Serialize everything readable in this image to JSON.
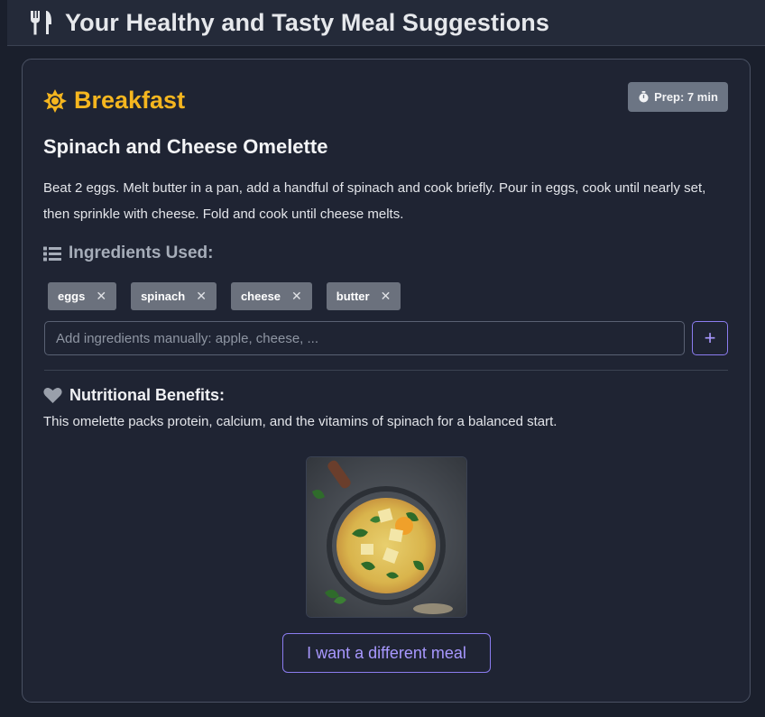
{
  "header": {
    "title": "Your Healthy and Tasty Meal Suggestions",
    "icon": "fork-knife-icon"
  },
  "meal": {
    "type": "Breakfast",
    "type_icon": "sun-icon",
    "prep": "Prep: 7 min",
    "name": "Spinach and Cheese Omelette",
    "description": "Beat 2 eggs. Melt butter in a pan, add a handful of spinach and cook briefly. Pour in eggs, cook until nearly set, then sprinkle with cheese. Fold and cook until cheese melts.",
    "ingredients_heading": "Ingredients Used:",
    "ingredients": [
      "eggs",
      "spinach",
      "cheese",
      "butter"
    ],
    "remove_glyph": "✕",
    "input_placeholder": "Add ingredients manually: apple, cheese, ...",
    "add_label": "+",
    "nutrition_heading": "Nutritional Benefits:",
    "nutrition_text": "This omelette packs protein, calcium, and the vitamins of spinach for a balanced start.",
    "different_button": "I want a different meal"
  },
  "colors": {
    "background": "#1a1f2c",
    "accent_yellow": "#f5b61f",
    "accent_purple": "#a898ff",
    "chip": "#6b717d",
    "badge": "#6c7584"
  }
}
